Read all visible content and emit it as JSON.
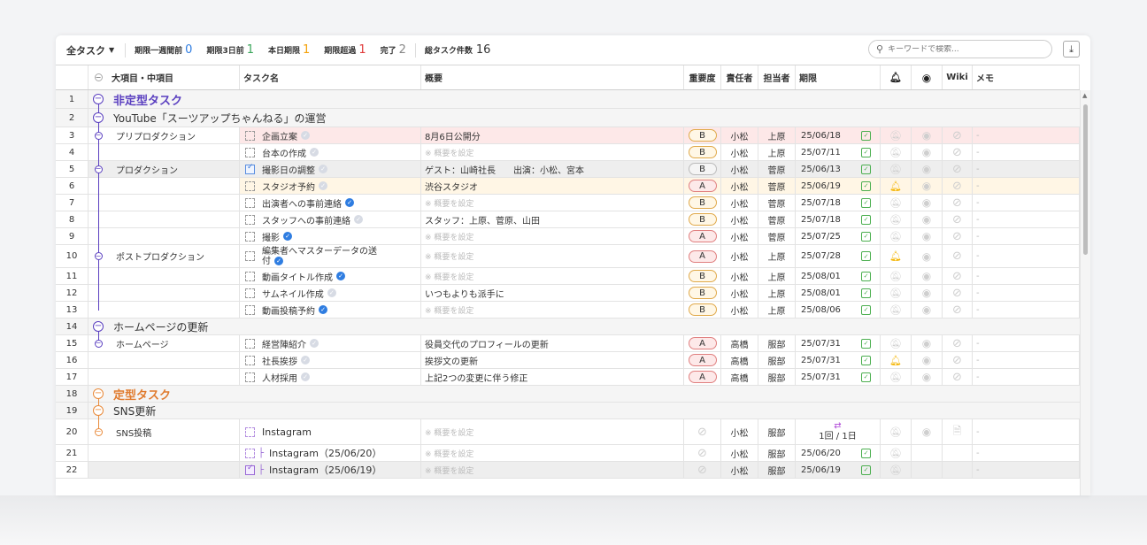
{
  "toolbar": {
    "view_label": "全タスク",
    "stats": [
      {
        "label": "期限一週間前",
        "value": "0",
        "color": "#2f7de1"
      },
      {
        "label": "期限3日前",
        "value": "1",
        "color": "#3aa65a"
      },
      {
        "label": "本日期限",
        "value": "1",
        "color": "#f4a20a"
      },
      {
        "label": "期限超過",
        "value": "1",
        "color": "#e03b3b"
      },
      {
        "label": "完了",
        "value": "2",
        "color": "#888888"
      }
    ],
    "total_label": "総タスク件数",
    "total_value": "16",
    "search_placeholder": "キーワードで検索..."
  },
  "headers": {
    "category": "大項目・中項目",
    "task": "タスク名",
    "summary": "概要",
    "importance": "重要度",
    "owner": "責任者",
    "assignee": "担当者",
    "due": "期限",
    "wiki": "Wiki",
    "memo": "メモ"
  },
  "rows": [
    {
      "no": "1",
      "kind": "group",
      "title": "非定型タスク",
      "style": "purple"
    },
    {
      "no": "2",
      "kind": "sub",
      "title": "YouTube「スーツアップちゃんねる」の運営"
    },
    {
      "no": "3",
      "category": "プリプロダクション",
      "task": "企画立案",
      "verified": "faint",
      "summary": "8月6日公開分",
      "imp": "B",
      "owner": "小松",
      "assignee": "上原",
      "due": "25/06/18",
      "bell": "off",
      "bg": "#fde8e8"
    },
    {
      "no": "4",
      "category": "",
      "task": "台本の作成",
      "verified": "faint",
      "summary": "",
      "imp": "B",
      "owner": "小松",
      "assignee": "上原",
      "due": "25/07/11",
      "bell": "off",
      "bg": "#ffffff"
    },
    {
      "no": "5",
      "category": "プロダクション",
      "task": "撮影日の調整",
      "done": true,
      "verified": "faint",
      "summary": "ゲスト：山崎社長　　出演：小松、宮本",
      "imp": "B",
      "impGray": true,
      "owner": "小松",
      "assignee": "菅原",
      "due": "25/06/13",
      "bell": "off",
      "bg": "#eeeeee"
    },
    {
      "no": "6",
      "category": "",
      "task": "スタジオ予約",
      "verified": "faint",
      "summary": "渋谷スタジオ",
      "imp": "A",
      "owner": "小松",
      "assignee": "菅原",
      "due": "25/06/19",
      "bell": "on",
      "bg": "#fff6e5"
    },
    {
      "no": "7",
      "category": "",
      "task": "出演者への事前連絡",
      "verified": "blue",
      "summary": "",
      "imp": "B",
      "owner": "小松",
      "assignee": "菅原",
      "due": "25/07/18",
      "bell": "off",
      "bg": "#ffffff"
    },
    {
      "no": "8",
      "category": "",
      "task": "スタッフへの事前連絡",
      "verified": "faint",
      "summary": "スタッフ：上原、菅原、山田",
      "imp": "B",
      "owner": "小松",
      "assignee": "菅原",
      "due": "25/07/18",
      "bell": "off",
      "bg": "#ffffff"
    },
    {
      "no": "9",
      "category": "",
      "task": "撮影",
      "verified": "blue",
      "summary": "",
      "imp": "A",
      "owner": "小松",
      "assignee": "菅原",
      "due": "25/07/25",
      "bell": "off",
      "bg": "#ffffff"
    },
    {
      "no": "10",
      "category": "ポストプロダクション",
      "task": "編集者へマスターデータの送付",
      "task2": "付",
      "verified": "blue",
      "summary": "",
      "imp": "A",
      "owner": "小松",
      "assignee": "上原",
      "due": "25/07/28",
      "bell": "on",
      "bg": "#ffffff"
    },
    {
      "no": "11",
      "category": "",
      "task": "動画タイトル作成",
      "verified": "blue",
      "summary": "",
      "imp": "B",
      "owner": "小松",
      "assignee": "上原",
      "due": "25/08/01",
      "bell": "off",
      "bg": "#ffffff"
    },
    {
      "no": "12",
      "category": "",
      "task": "サムネイル作成",
      "verified": "faint",
      "summary": "いつもよりも派手に",
      "imp": "B",
      "owner": "小松",
      "assignee": "上原",
      "due": "25/08/01",
      "bell": "off",
      "bg": "#ffffff"
    },
    {
      "no": "13",
      "category": "",
      "task": "動画投稿予約",
      "verified": "blue",
      "summary": "",
      "imp": "B",
      "owner": "小松",
      "assignee": "上原",
      "due": "25/08/06",
      "bell": "off",
      "bg": "#ffffff"
    },
    {
      "no": "14",
      "kind": "sub",
      "title": "ホームページの更新"
    },
    {
      "no": "15",
      "category": "ホームページ",
      "task": "経営陣紹介",
      "verified": "faint",
      "summary": "役員交代のプロフィールの更新",
      "imp": "A",
      "owner": "高橋",
      "assignee": "服部",
      "due": "25/07/31",
      "bell": "off",
      "bg": "#ffffff"
    },
    {
      "no": "16",
      "category": "",
      "task": "社長挨拶",
      "verified": "faint",
      "summary": "挨拶文の更新",
      "imp": "A",
      "owner": "高橋",
      "assignee": "服部",
      "due": "25/07/31",
      "bell": "on",
      "bg": "#ffffff"
    },
    {
      "no": "17",
      "category": "",
      "task": "人材採用",
      "verified": "faint",
      "summary": "上記2つの変更に伴う修正",
      "imp": "A",
      "owner": "高橋",
      "assignee": "服部",
      "due": "25/07/31",
      "bell": "off",
      "bg": "#ffffff"
    },
    {
      "no": "18",
      "kind": "group",
      "title": "定型タスク",
      "style": "orange"
    },
    {
      "no": "19",
      "kind": "sub",
      "title": "SNS更新",
      "style": "orange"
    },
    {
      "no": "20",
      "category": "SNS投稿",
      "task": "Instagram",
      "summary": "",
      "owner": "小松",
      "assignee": "服部",
      "recurrence": "1回 / 1日",
      "bg": "#ffffff"
    },
    {
      "no": "21",
      "category": "",
      "task": "Instagram（25/06/20）",
      "child": true,
      "summary": "",
      "owner": "小松",
      "assignee": "服部",
      "due": "25/06/20",
      "bg": "#ffffff"
    },
    {
      "no": "22",
      "category": "",
      "task": "Instagram（25/06/19）",
      "child": true,
      "done": true,
      "summary": "",
      "owner": "小松",
      "assignee": "服部",
      "due": "25/06/19",
      "bg": "#eeeeee"
    }
  ],
  "placeholder": "※ 概要を設定",
  "memo_dash": "-"
}
